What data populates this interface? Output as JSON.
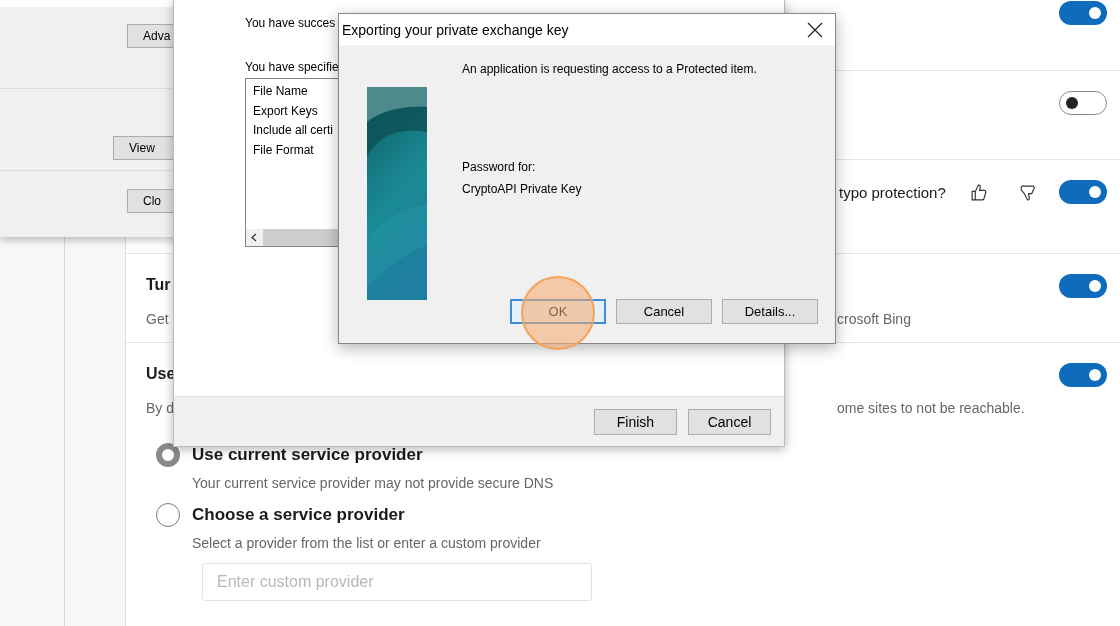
{
  "settings_page": {
    "rows": [
      {
        "on": true
      },
      {
        "on": false
      },
      {
        "title_tail": "typo protection?",
        "feedback": true,
        "on": true
      },
      {
        "title": "Tur",
        "description": "Get",
        "description_tail": "crosoft Bing",
        "on": true
      },
      {
        "title": "Use",
        "description": "By d",
        "description_tail": "ome sites to not be reachable.",
        "on": true
      }
    ],
    "dns_options": [
      {
        "label": "Use current service provider",
        "description": "Your current service provider may not provide secure DNS",
        "selected": true
      },
      {
        "label": "Choose a service provider",
        "description": "Select a provider from the list or enter a custom provider",
        "selected": false
      }
    ],
    "custom_provider": {
      "placeholder": "Enter custom provider"
    }
  },
  "back_window": {
    "buttons": [
      "Adva",
      "View",
      "Clo"
    ]
  },
  "wizard": {
    "lines": [
      "You have succes",
      "You have specifie"
    ],
    "summary_list": [
      "File Name",
      "Export Keys",
      "Include all certi",
      "File Format"
    ],
    "buttons": [
      "Finish",
      "Cancel"
    ]
  },
  "dialog": {
    "title": "Exporting your private exchange key",
    "message": "An application is requesting access to a Protected item.",
    "password_label": "Password for:",
    "key_name": "CryptoAPI Private Key",
    "buttons": [
      {
        "label": "OK",
        "focused": true
      },
      {
        "label": "Cancel",
        "focused": false
      },
      {
        "label": "Details...",
        "focused": false
      }
    ]
  }
}
